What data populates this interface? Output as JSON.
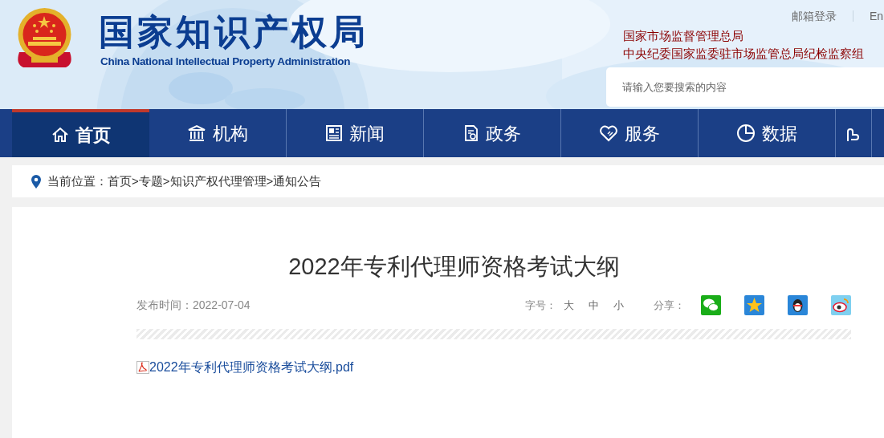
{
  "header": {
    "title": "国家知识产权局",
    "subtitle": "China National Intellectual Property Administration",
    "top_links": [
      "邮箱登录",
      "En"
    ],
    "agencies": [
      "国家市场监督管理总局",
      "中央纪委国家监委驻市场监管总局纪检监察组"
    ],
    "search": {
      "placeholder": "请输入您要搜索的内容"
    }
  },
  "nav": {
    "items": [
      {
        "label": "首页",
        "selected": true
      },
      {
        "label": "机构",
        "selected": false
      },
      {
        "label": "新闻",
        "selected": false
      },
      {
        "label": "政务",
        "selected": false
      },
      {
        "label": "服务",
        "selected": false
      },
      {
        "label": "数据",
        "selected": false
      },
      {
        "selected": false
      }
    ]
  },
  "breadcrumb": {
    "label": "当前位置：",
    "separator": ">",
    "items": [
      "首页",
      "专题",
      "知识产权代理管理",
      "通知公告"
    ]
  },
  "article": {
    "title": "2022年专利代理师资格考试大纲",
    "date_label": "发布时间：",
    "date": "2022-07-04",
    "font_size_label": "字号：",
    "font_sizes": [
      "大",
      "中",
      "小"
    ],
    "share_label": "分享：",
    "attachment": "2022年专利代理师资格考试大纲.pdf"
  }
}
